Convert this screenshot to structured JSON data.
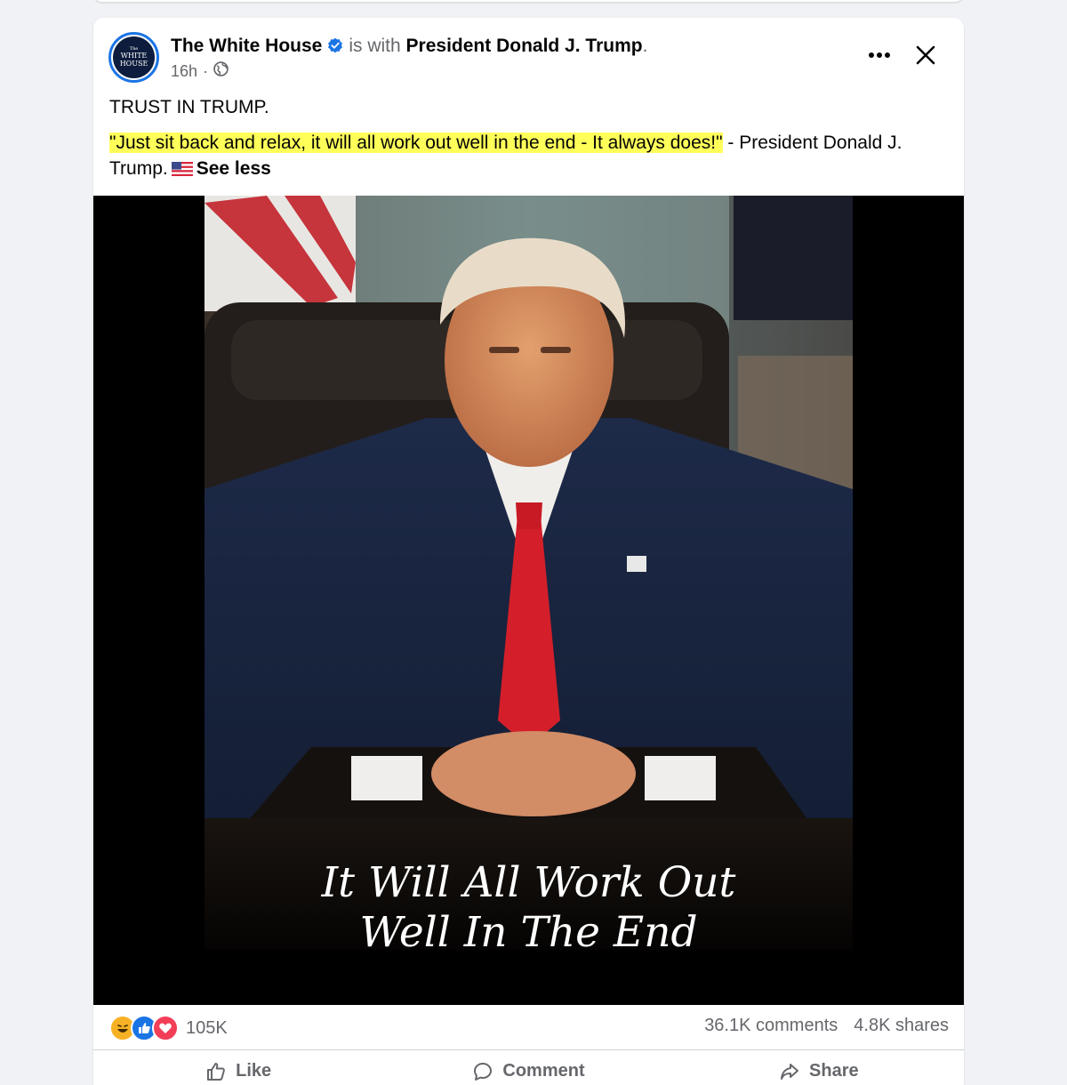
{
  "post": {
    "page_name": "The White House",
    "with_text": "is with",
    "with_name": "President Donald J. Trump",
    "with_end": ".",
    "time": "16h",
    "privacy_icon": "globe-icon",
    "avatar_text_1": "The",
    "avatar_text_2": "WHITE",
    "avatar_text_3": "HOUSE",
    "text_line1": "TRUST IN TRUMP.",
    "quote": "\"Just sit back and relax, it will all work out well in the end - It always does!\"",
    "quote_after": " - President Donald J. Trump.",
    "see_less": "See less",
    "image_caption_1": "It Will All Work Out",
    "image_caption_2": "Well In The End"
  },
  "stats": {
    "reaction_icons": [
      "haha-icon",
      "like-icon",
      "love-icon"
    ],
    "reaction_count": "105K",
    "comments": "36.1K comments",
    "shares": "4.8K shares"
  },
  "actions": {
    "like": "Like",
    "comment": "Comment",
    "share": "Share"
  },
  "colors": {
    "brand_blue": "#1b74e4",
    "highlight": "#ffff5a",
    "secondary_text": "#65676b",
    "love_red": "#f33e58",
    "haha_yellow": "#f7b125"
  }
}
